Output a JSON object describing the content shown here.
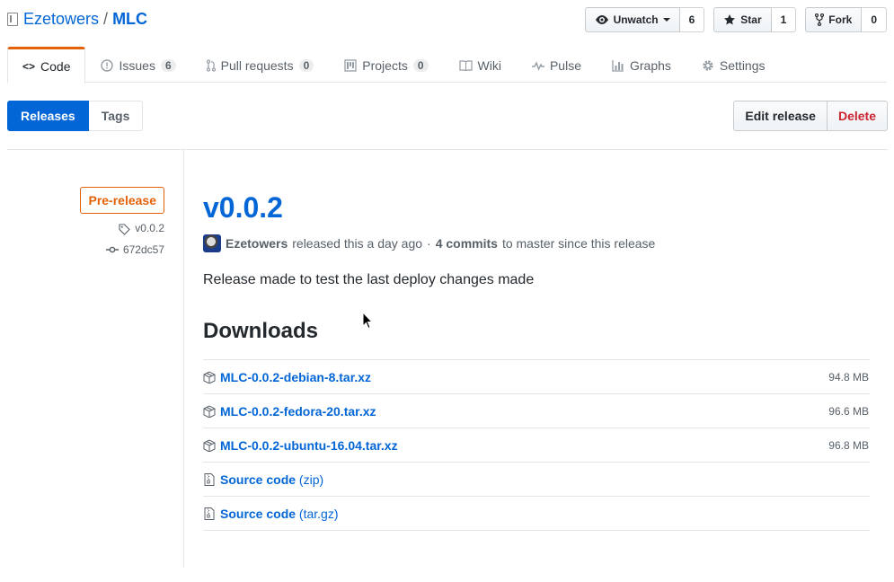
{
  "repo": {
    "owner": "Ezetowers",
    "separator": "/",
    "name": "MLC"
  },
  "actions": [
    {
      "label": "Unwatch",
      "count": "6",
      "icon": "eye-icon"
    },
    {
      "label": "Star",
      "count": "1",
      "icon": "star-icon"
    },
    {
      "label": "Fork",
      "count": "0",
      "icon": "fork-icon"
    }
  ],
  "nav": {
    "code": "Code",
    "issues": "Issues",
    "issues_count": "6",
    "pulls": "Pull requests",
    "pulls_count": "0",
    "projects": "Projects",
    "projects_count": "0",
    "wiki": "Wiki",
    "pulse": "Pulse",
    "graphs": "Graphs",
    "settings": "Settings"
  },
  "subnav": {
    "releases": "Releases",
    "tags": "Tags"
  },
  "release_actions": {
    "edit": "Edit release",
    "delete": "Delete"
  },
  "release": {
    "label": "Pre-release",
    "tag": "v0.0.2",
    "commit": "672dc57",
    "title": "v0.0.2",
    "author": "Ezetowers",
    "released_text": "released this a day ago",
    "dot": "·",
    "commits": "4 commits",
    "since_text": "to master since this release",
    "body": "Release made to test the last deploy changes made",
    "downloads_title": "Downloads"
  },
  "downloads": [
    {
      "name": "MLC-0.0.2-debian-8.tar.xz",
      "size": "94.8 MB"
    },
    {
      "name": "MLC-0.0.2-fedora-20.tar.xz",
      "size": "96.6 MB"
    },
    {
      "name": "MLC-0.0.2-ubuntu-16.04.tar.xz",
      "size": "96.8 MB"
    }
  ],
  "source": [
    {
      "name": "Source code",
      "ext": "(zip)"
    },
    {
      "name": "Source code",
      "ext": "(tar.gz)"
    }
  ],
  "colors": {
    "accent": "#0366d6",
    "prerelease": "#e36209",
    "danger": "#cb2431"
  }
}
